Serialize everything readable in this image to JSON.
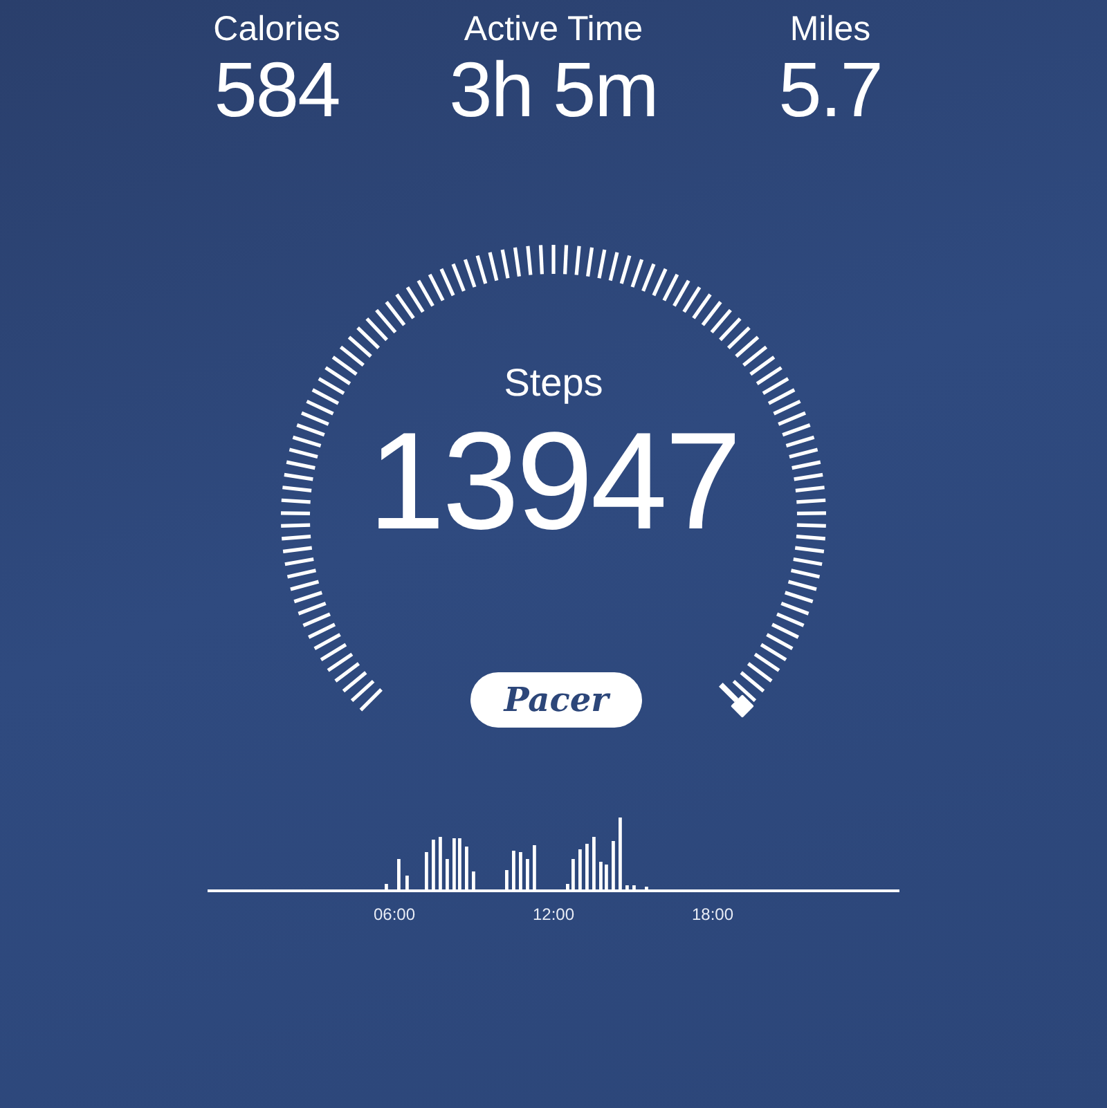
{
  "stats": [
    {
      "label": "Calories",
      "value": "584"
    },
    {
      "label": "Active Time",
      "value": "3h 5m"
    },
    {
      "label": "Miles",
      "value": "5.7"
    }
  ],
  "gauge": {
    "label": "Steps",
    "value": "13947"
  },
  "logo": "Pacer",
  "activity": {
    "axis_labels": [
      "06:00",
      "12:00",
      "18:00"
    ]
  }
}
